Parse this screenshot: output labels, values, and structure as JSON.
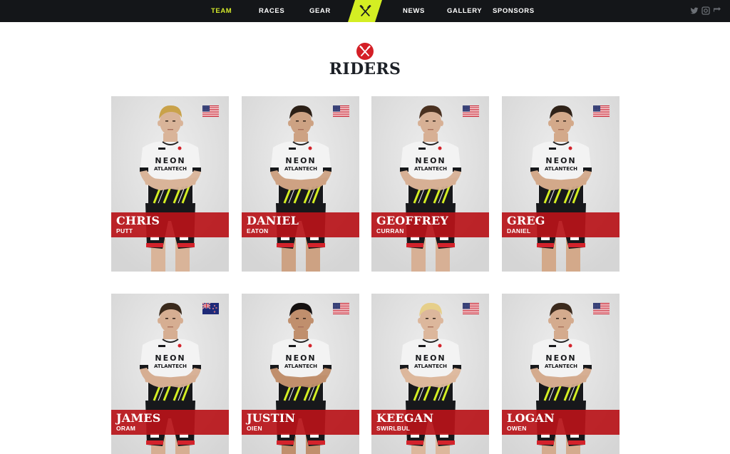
{
  "nav": {
    "items": [
      {
        "label": "TEAM",
        "active": true
      },
      {
        "label": "RACES",
        "active": false
      },
      {
        "label": "GEAR",
        "active": false
      },
      {
        "label": "NEWS",
        "active": false
      },
      {
        "label": "GALLERY",
        "active": false
      },
      {
        "label": "SPONSORS",
        "active": false
      }
    ],
    "logo_icon": "crossed-hammers-icon",
    "social": [
      "twitter-icon",
      "instagram-icon",
      "share-icon"
    ]
  },
  "page": {
    "header_icon": "crossed-hammers-badge-icon",
    "title": "RIDERS"
  },
  "riders": [
    {
      "first": "CHRIS",
      "last": "PUTT",
      "flag": "usa-flag-icon"
    },
    {
      "first": "DANIEL",
      "last": "EATON",
      "flag": "usa-flag-icon"
    },
    {
      "first": "GEOFFREY",
      "last": "CURRAN",
      "flag": "usa-flag-icon"
    },
    {
      "first": "GREG",
      "last": "DANIEL",
      "flag": "usa-flag-icon"
    },
    {
      "first": "JAMES",
      "last": "ORAM",
      "flag": "new-zealand-flag-icon"
    },
    {
      "first": "JUSTIN",
      "last": "OIEN",
      "flag": "usa-flag-icon"
    },
    {
      "first": "KEEGAN",
      "last": "SWIRLBUL",
      "flag": "usa-flag-icon"
    },
    {
      "first": "LOGAN",
      "last": "OWEN",
      "flag": "usa-flag-icon"
    }
  ],
  "jersey": {
    "line1": "NEON",
    "line2": "ATLANTECH"
  },
  "colors": {
    "nav_bg": "#141619",
    "accent": "#d4ee23",
    "brand_red": "#b81419",
    "title": "#1c2026"
  }
}
